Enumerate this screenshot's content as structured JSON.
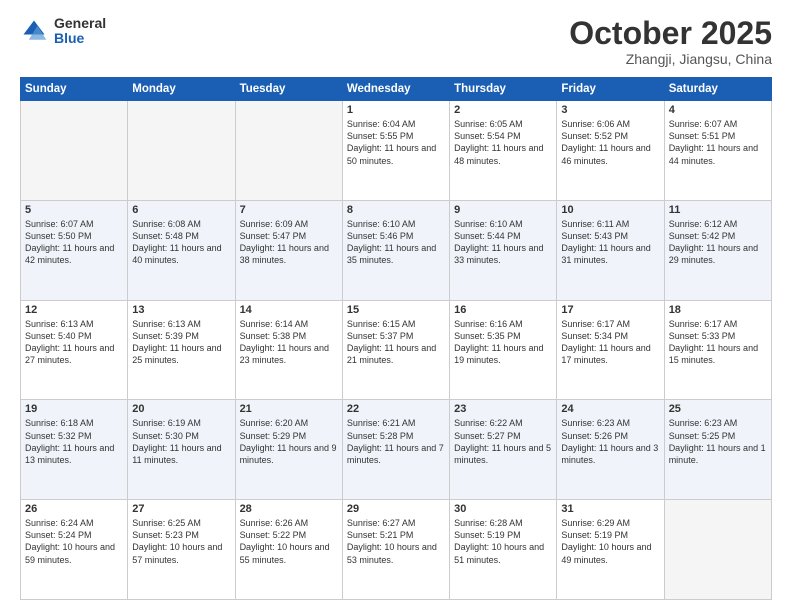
{
  "header": {
    "logo_general": "General",
    "logo_blue": "Blue",
    "month": "October 2025",
    "location": "Zhangji, Jiangsu, China"
  },
  "weekdays": [
    "Sunday",
    "Monday",
    "Tuesday",
    "Wednesday",
    "Thursday",
    "Friday",
    "Saturday"
  ],
  "weeks": [
    [
      {
        "day": "",
        "empty": true
      },
      {
        "day": "",
        "empty": true
      },
      {
        "day": "",
        "empty": true
      },
      {
        "day": "1",
        "sunrise": "6:04 AM",
        "sunset": "5:55 PM",
        "daylight": "11 hours and 50 minutes."
      },
      {
        "day": "2",
        "sunrise": "6:05 AM",
        "sunset": "5:54 PM",
        "daylight": "11 hours and 48 minutes."
      },
      {
        "day": "3",
        "sunrise": "6:06 AM",
        "sunset": "5:52 PM",
        "daylight": "11 hours and 46 minutes."
      },
      {
        "day": "4",
        "sunrise": "6:07 AM",
        "sunset": "5:51 PM",
        "daylight": "11 hours and 44 minutes."
      }
    ],
    [
      {
        "day": "5",
        "sunrise": "6:07 AM",
        "sunset": "5:50 PM",
        "daylight": "11 hours and 42 minutes."
      },
      {
        "day": "6",
        "sunrise": "6:08 AM",
        "sunset": "5:48 PM",
        "daylight": "11 hours and 40 minutes."
      },
      {
        "day": "7",
        "sunrise": "6:09 AM",
        "sunset": "5:47 PM",
        "daylight": "11 hours and 38 minutes."
      },
      {
        "day": "8",
        "sunrise": "6:10 AM",
        "sunset": "5:46 PM",
        "daylight": "11 hours and 35 minutes."
      },
      {
        "day": "9",
        "sunrise": "6:10 AM",
        "sunset": "5:44 PM",
        "daylight": "11 hours and 33 minutes."
      },
      {
        "day": "10",
        "sunrise": "6:11 AM",
        "sunset": "5:43 PM",
        "daylight": "11 hours and 31 minutes."
      },
      {
        "day": "11",
        "sunrise": "6:12 AM",
        "sunset": "5:42 PM",
        "daylight": "11 hours and 29 minutes."
      }
    ],
    [
      {
        "day": "12",
        "sunrise": "6:13 AM",
        "sunset": "5:40 PM",
        "daylight": "11 hours and 27 minutes."
      },
      {
        "day": "13",
        "sunrise": "6:13 AM",
        "sunset": "5:39 PM",
        "daylight": "11 hours and 25 minutes."
      },
      {
        "day": "14",
        "sunrise": "6:14 AM",
        "sunset": "5:38 PM",
        "daylight": "11 hours and 23 minutes."
      },
      {
        "day": "15",
        "sunrise": "6:15 AM",
        "sunset": "5:37 PM",
        "daylight": "11 hours and 21 minutes."
      },
      {
        "day": "16",
        "sunrise": "6:16 AM",
        "sunset": "5:35 PM",
        "daylight": "11 hours and 19 minutes."
      },
      {
        "day": "17",
        "sunrise": "6:17 AM",
        "sunset": "5:34 PM",
        "daylight": "11 hours and 17 minutes."
      },
      {
        "day": "18",
        "sunrise": "6:17 AM",
        "sunset": "5:33 PM",
        "daylight": "11 hours and 15 minutes."
      }
    ],
    [
      {
        "day": "19",
        "sunrise": "6:18 AM",
        "sunset": "5:32 PM",
        "daylight": "11 hours and 13 minutes."
      },
      {
        "day": "20",
        "sunrise": "6:19 AM",
        "sunset": "5:30 PM",
        "daylight": "11 hours and 11 minutes."
      },
      {
        "day": "21",
        "sunrise": "6:20 AM",
        "sunset": "5:29 PM",
        "daylight": "11 hours and 9 minutes."
      },
      {
        "day": "22",
        "sunrise": "6:21 AM",
        "sunset": "5:28 PM",
        "daylight": "11 hours and 7 minutes."
      },
      {
        "day": "23",
        "sunrise": "6:22 AM",
        "sunset": "5:27 PM",
        "daylight": "11 hours and 5 minutes."
      },
      {
        "day": "24",
        "sunrise": "6:23 AM",
        "sunset": "5:26 PM",
        "daylight": "11 hours and 3 minutes."
      },
      {
        "day": "25",
        "sunrise": "6:23 AM",
        "sunset": "5:25 PM",
        "daylight": "11 hours and 1 minute."
      }
    ],
    [
      {
        "day": "26",
        "sunrise": "6:24 AM",
        "sunset": "5:24 PM",
        "daylight": "10 hours and 59 minutes."
      },
      {
        "day": "27",
        "sunrise": "6:25 AM",
        "sunset": "5:23 PM",
        "daylight": "10 hours and 57 minutes."
      },
      {
        "day": "28",
        "sunrise": "6:26 AM",
        "sunset": "5:22 PM",
        "daylight": "10 hours and 55 minutes."
      },
      {
        "day": "29",
        "sunrise": "6:27 AM",
        "sunset": "5:21 PM",
        "daylight": "10 hours and 53 minutes."
      },
      {
        "day": "30",
        "sunrise": "6:28 AM",
        "sunset": "5:19 PM",
        "daylight": "10 hours and 51 minutes."
      },
      {
        "day": "31",
        "sunrise": "6:29 AM",
        "sunset": "5:19 PM",
        "daylight": "10 hours and 49 minutes."
      },
      {
        "day": "",
        "empty": true
      }
    ]
  ]
}
